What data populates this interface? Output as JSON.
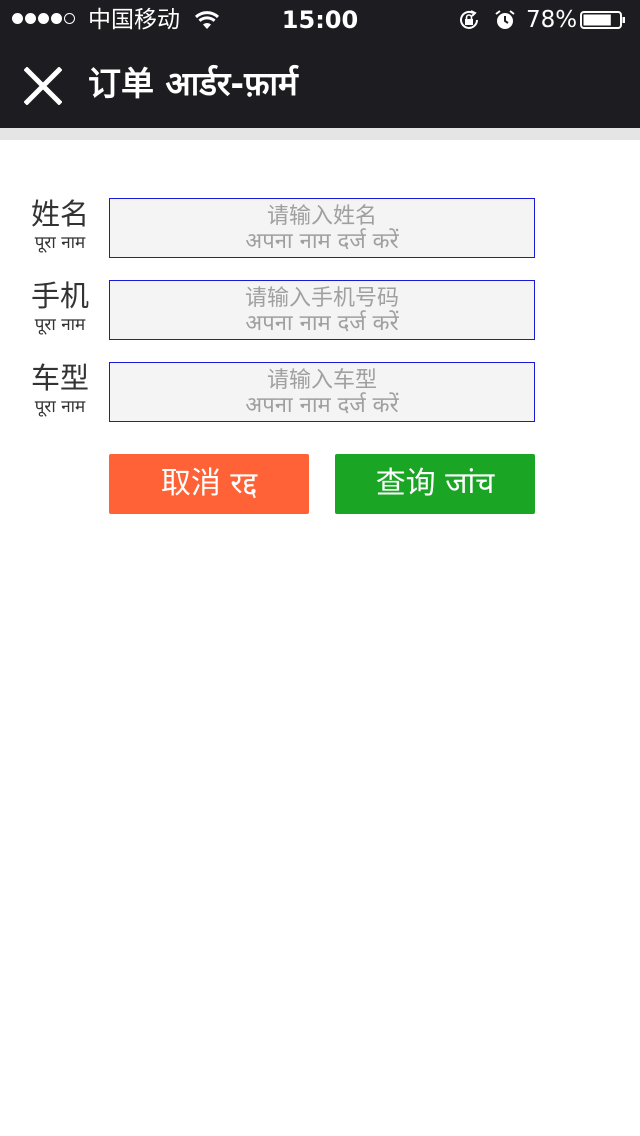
{
  "status_bar": {
    "carrier": "中国移动",
    "time": "15:00",
    "battery_percent": "78%",
    "signal_bars_filled": 4,
    "signal_bars_total": 5,
    "battery_level": 0.78,
    "icons": [
      "signal-dots-icon",
      "wifi-icon",
      "rotation-lock-icon",
      "alarm-icon",
      "battery-icon"
    ]
  },
  "nav": {
    "title": "订单 आर्डर-फ़ार्म",
    "close_icon": "close-icon"
  },
  "form": {
    "fields": [
      {
        "label_zh": "姓名",
        "label_hi": "पूरा नाम",
        "placeholder_zh": "请输入姓名",
        "placeholder_hi": "अपना नाम दर्ज करें"
      },
      {
        "label_zh": "手机",
        "label_hi": "पूरा नाम",
        "placeholder_zh": "请输入手机号码",
        "placeholder_hi": "अपना नाम दर्ज करें"
      },
      {
        "label_zh": "车型",
        "label_hi": "पूरा नाम",
        "placeholder_zh": "请输入车型",
        "placeholder_hi": "अपना नाम दर्ज करें"
      }
    ],
    "cancel_label": "取消 रद्द",
    "query_label": "查询 जांच"
  },
  "colors": {
    "bar_background": "#1d1d21",
    "field_border": "#1a1ad6",
    "field_background": "#f4f4f4",
    "cancel_button": "#ff6236",
    "query_button": "#1aa624"
  }
}
